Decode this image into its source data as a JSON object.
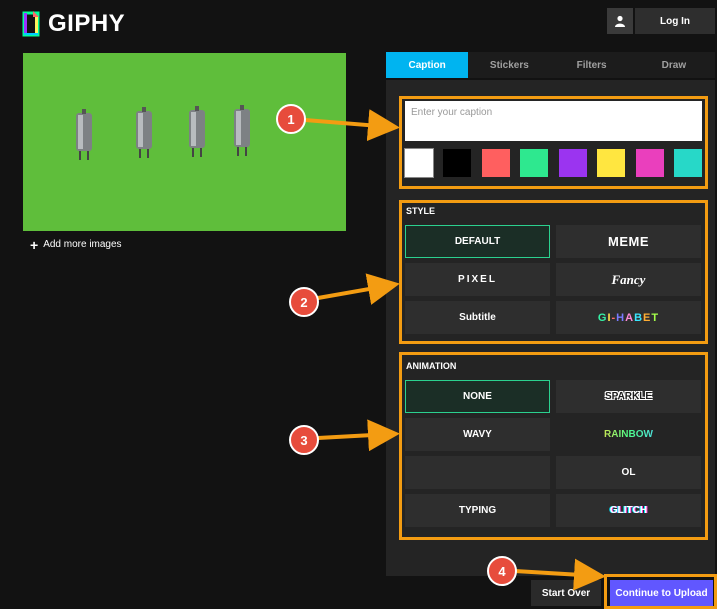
{
  "brand": {
    "name": "GIPHY"
  },
  "header": {
    "login_label": "Log In"
  },
  "preview": {
    "add_more_label": "Add more images"
  },
  "tabs": [
    {
      "label": "Caption",
      "active": true
    },
    {
      "label": "Stickers",
      "active": false
    },
    {
      "label": "Filters",
      "active": false
    },
    {
      "label": "Draw",
      "active": false
    }
  ],
  "caption": {
    "placeholder": "Enter your caption",
    "value": ""
  },
  "colors": [
    "#ffffff",
    "#000000",
    "#ff5f5f",
    "#2ee88f",
    "#9b34f0",
    "#ffe640",
    "#ea3fbd",
    "#27d8c8"
  ],
  "style": {
    "label": "STYLE",
    "options": [
      "DEFAULT",
      "MEME",
      "PIXEL",
      "Fancy",
      "Subtitle",
      "GI-HABET"
    ],
    "selected": "DEFAULT"
  },
  "animation": {
    "label": "ANIMATION",
    "options": [
      "NONE",
      "SPARKLE",
      "WAVY",
      "RAINBOW",
      "",
      "OL",
      "TYPING",
      "GLITCH"
    ],
    "selected": "NONE"
  },
  "callouts": [
    "1",
    "2",
    "3",
    "4"
  ],
  "footer": {
    "start_over_label": "Start Over",
    "continue_label": "Continue to Upload"
  },
  "accent_colors": {
    "tab_active": "#00b4f0",
    "callout": "#f39c12",
    "badge": "#e74c3c",
    "continue": "#6157ff",
    "preview_bg": "#5fbe3b"
  }
}
